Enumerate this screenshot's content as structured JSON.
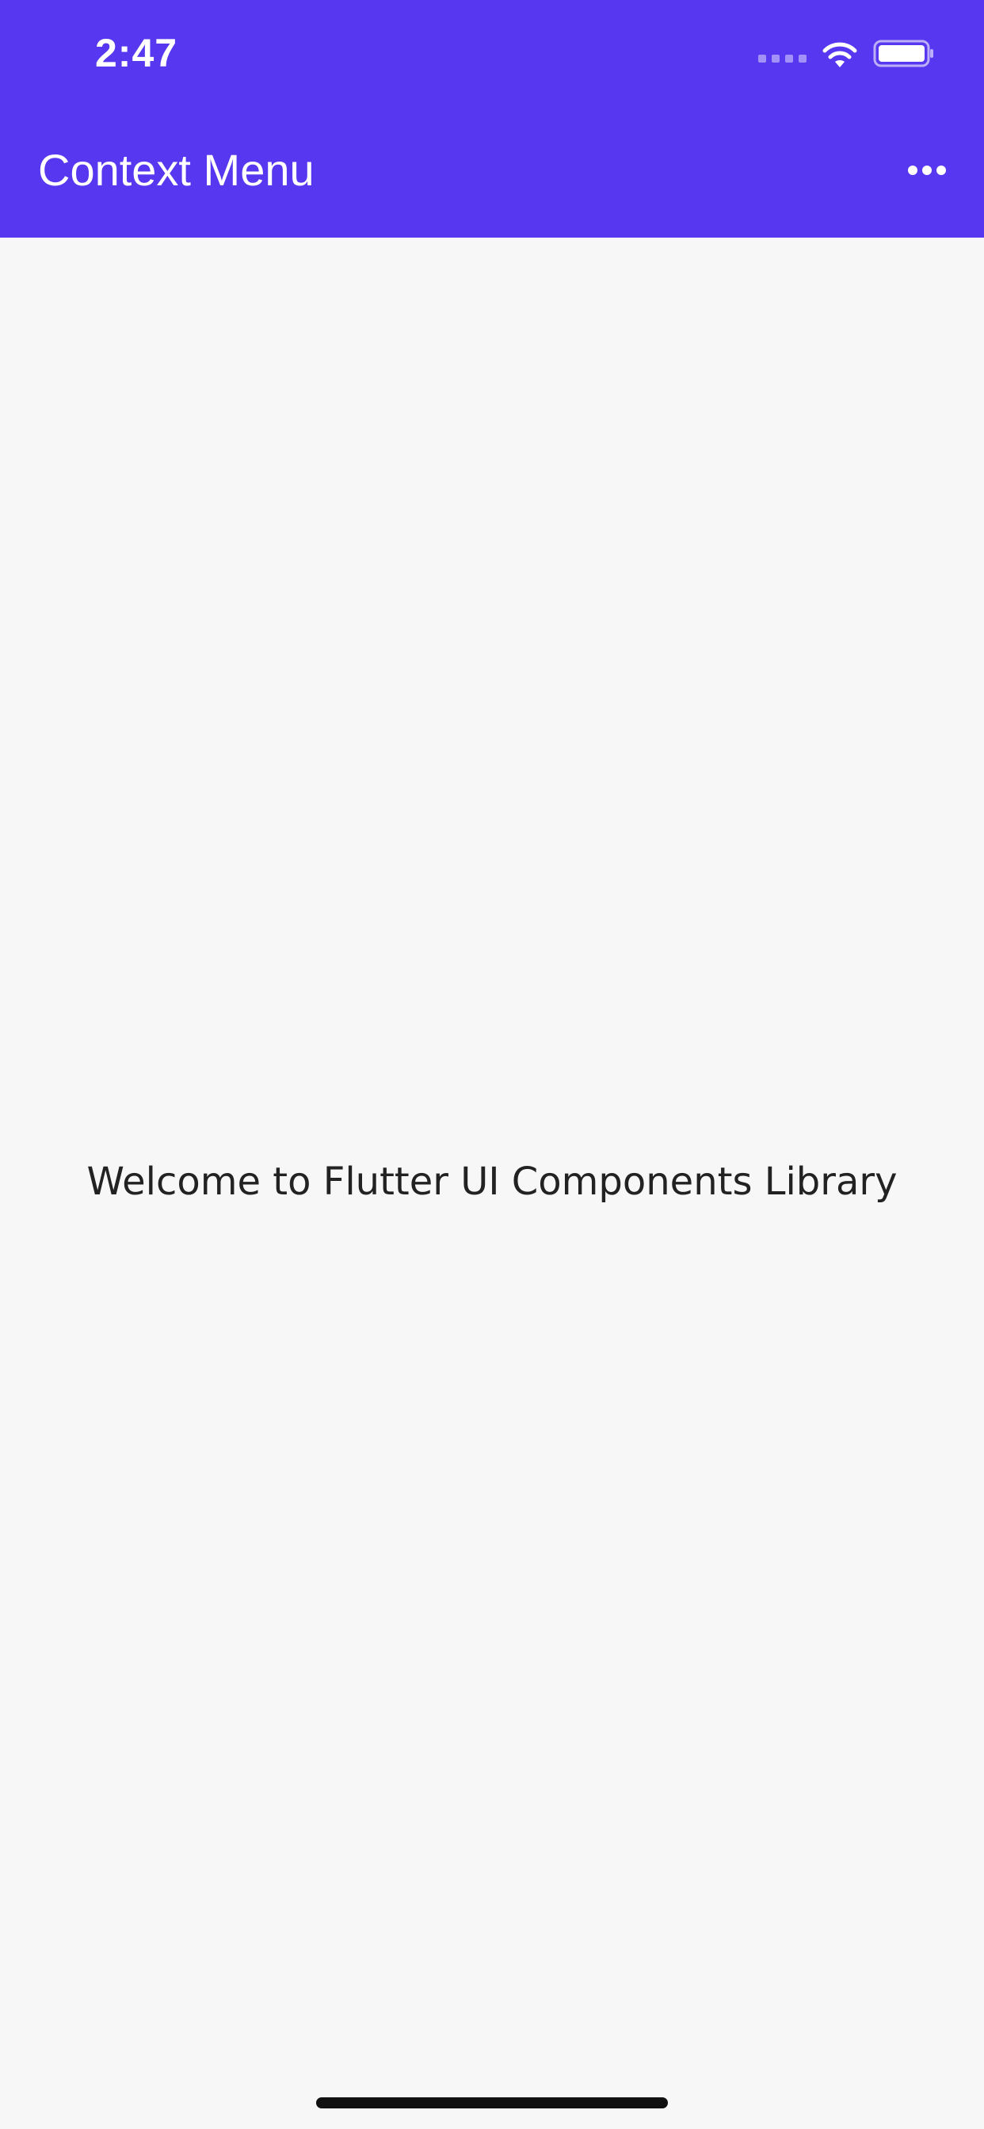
{
  "status_bar": {
    "time": "2:47",
    "signal_icon": "signal-dots-icon",
    "wifi_icon": "wifi-icon",
    "battery_icon": "battery-icon"
  },
  "app_bar": {
    "title": "Context Menu",
    "overflow_icon": "more-horizontal-icon",
    "background_color": "#5738f0"
  },
  "body": {
    "message": "Welcome to Flutter UI Components Library",
    "background_color": "#f7f7f7"
  }
}
